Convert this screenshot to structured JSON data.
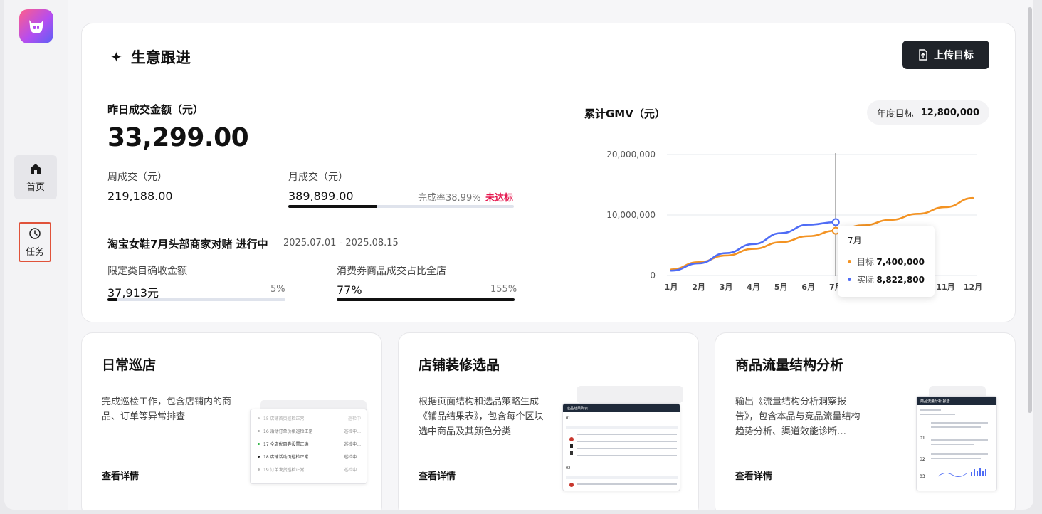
{
  "nav": {
    "home_label": "首页",
    "task_label": "任务"
  },
  "header": {
    "title": "生意跟进",
    "upload_label": "上传目标"
  },
  "stats": {
    "yesterday_label": "昨日成交金额（元）",
    "yesterday_value": "33,299.00",
    "week_label": "周成交（元）",
    "week_value": "219,188.00",
    "month_label": "月成交（元）",
    "month_value": "389,899.00",
    "month_progress": 0.3899,
    "month_rate_text": "完成率38.99%",
    "month_status": "未达标"
  },
  "event": {
    "title": "淘宝女鞋7月头部商家对赌 进行中",
    "date_range": "2025.07.01 - 2025.08.15",
    "metric1_label": "限定类目确收金额",
    "metric1_value": "37,913元",
    "metric1_pct": "5%",
    "metric1_progress": 0.05,
    "metric2_label": "消费券商品成交占比全店",
    "metric2_value": "77%",
    "metric2_pct": "155%",
    "metric2_progress": 1.0
  },
  "gmv": {
    "title": "累计GMV（元）",
    "goal_label": "年度目标",
    "goal_value": "12,800,000"
  },
  "chart_data": {
    "type": "line",
    "title": "累计GMV（元）",
    "categories": [
      "1月",
      "2月",
      "3月",
      "4月",
      "5月",
      "6月",
      "7月",
      "8月",
      "9月",
      "10月",
      "11月",
      "12月"
    ],
    "y_ticks": [
      "0",
      "10,000,000",
      "20,000,000"
    ],
    "ylim": [
      0,
      20000000
    ],
    "grid": true,
    "series": [
      {
        "name": "目标",
        "color": "#f39323",
        "values": [
          1000000,
          2200000,
          3300000,
          4400000,
          5500000,
          6500000,
          7400000,
          8300000,
          9200000,
          10200000,
          11300000,
          12800000
        ]
      },
      {
        "name": "实际",
        "color": "#4f6cf5",
        "values": [
          800000,
          2000000,
          3700000,
          5200000,
          7000000,
          8400000,
          8822800
        ]
      }
    ],
    "tooltip": {
      "month": "7月",
      "rows": [
        {
          "name": "目标",
          "value": "7,400,000",
          "color": "#f39323"
        },
        {
          "name": "实际",
          "value": "8,822,800",
          "color": "#4f6cf5"
        }
      ]
    },
    "hover_index": 6
  },
  "cards": [
    {
      "title": "日常巡店",
      "desc": "完成巡检工作，包含店铺内的商品、订单等异常排查",
      "link": "查看详情",
      "thumb_rows": [
        {
          "text": "15 店铺首页巡检正常",
          "status": "巡检中"
        },
        {
          "text": "16 活动订单价格巡检正常",
          "status": "巡检中..."
        },
        {
          "text": "17 全店优惠券设置正确",
          "status": "巡检中..."
        },
        {
          "text": "18 店铺活动页巡检正常",
          "status": "巡检中..."
        },
        {
          "text": "19 订单发货巡检正常",
          "status": "巡检中..."
        }
      ]
    },
    {
      "title": "店铺装修选品",
      "desc": "根据页面结构和选品策略生成《铺品结果表》，包含每个区块选中商品及其颜色分类",
      "link": "查看详情",
      "thumb_title": "选品结果列表"
    },
    {
      "title": "商品流量结构分析",
      "desc": "输出《流量结构分析洞察报告》，包含本品与竞品流量结构趋势分析、渠道效能诊断…",
      "link": "查看详情",
      "thumb_title": "商品流量分析 报告"
    }
  ]
}
